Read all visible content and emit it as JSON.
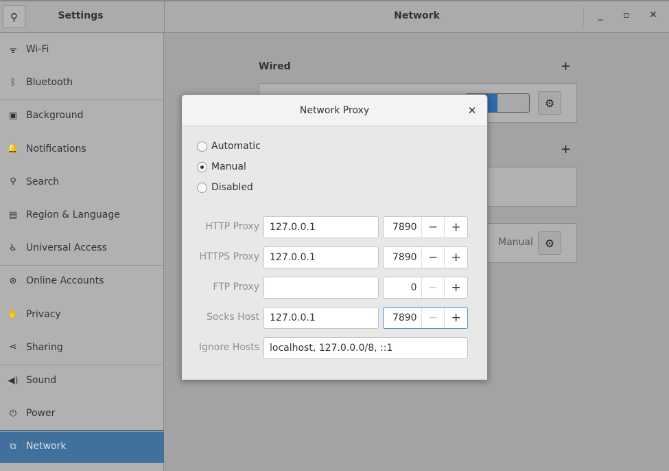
{
  "header": {
    "app_title": "Settings",
    "page_title": "Network"
  },
  "sidebar": {
    "items": [
      {
        "label": "Wi-Fi",
        "icon": "wifi-icon",
        "glyph": "ᯤ"
      },
      {
        "label": "Bluetooth",
        "icon": "bluetooth-icon",
        "glyph": "ᛒ"
      },
      {
        "label": "Background",
        "icon": "background-icon",
        "glyph": "▣"
      },
      {
        "label": "Notifications",
        "icon": "bell-icon",
        "glyph": "🔔"
      },
      {
        "label": "Search",
        "icon": "search-icon",
        "glyph": "⚲"
      },
      {
        "label": "Region & Language",
        "icon": "region-icon",
        "glyph": "▤"
      },
      {
        "label": "Universal Access",
        "icon": "accessibility-icon",
        "glyph": "♿"
      },
      {
        "label": "Online Accounts",
        "icon": "online-accounts-icon",
        "glyph": "⊛"
      },
      {
        "label": "Privacy",
        "icon": "privacy-hand-icon",
        "glyph": "✋"
      },
      {
        "label": "Sharing",
        "icon": "share-icon",
        "glyph": "⋖"
      },
      {
        "label": "Sound",
        "icon": "speaker-icon",
        "glyph": "◀)"
      },
      {
        "label": "Power",
        "icon": "power-icon",
        "glyph": "⏻"
      },
      {
        "label": "Network",
        "icon": "network-icon",
        "glyph": "⧉"
      }
    ],
    "selected": "Network"
  },
  "main": {
    "wired_label": "Wired",
    "proxy_status": "Manual"
  },
  "dialog": {
    "title": "Network Proxy",
    "modes": [
      {
        "label": "Automatic",
        "selected": false
      },
      {
        "label": "Manual",
        "selected": true
      },
      {
        "label": "Disabled",
        "selected": false
      }
    ],
    "rows": [
      {
        "label": "HTTP Proxy",
        "host": "127.0.0.1",
        "port": "7890"
      },
      {
        "label": "HTTPS Proxy",
        "host": "127.0.0.1",
        "port": "7890"
      },
      {
        "label": "FTP Proxy",
        "host": "",
        "port": "0"
      },
      {
        "label": "Socks Host",
        "host": "127.0.0.1",
        "port": "7890"
      }
    ],
    "ignore_label": "Ignore Hosts",
    "ignore_value": "localhost, 127.0.0.0/8, ::1"
  },
  "colors": {
    "accent": "#41709c",
    "focus": "#4a90d9"
  }
}
